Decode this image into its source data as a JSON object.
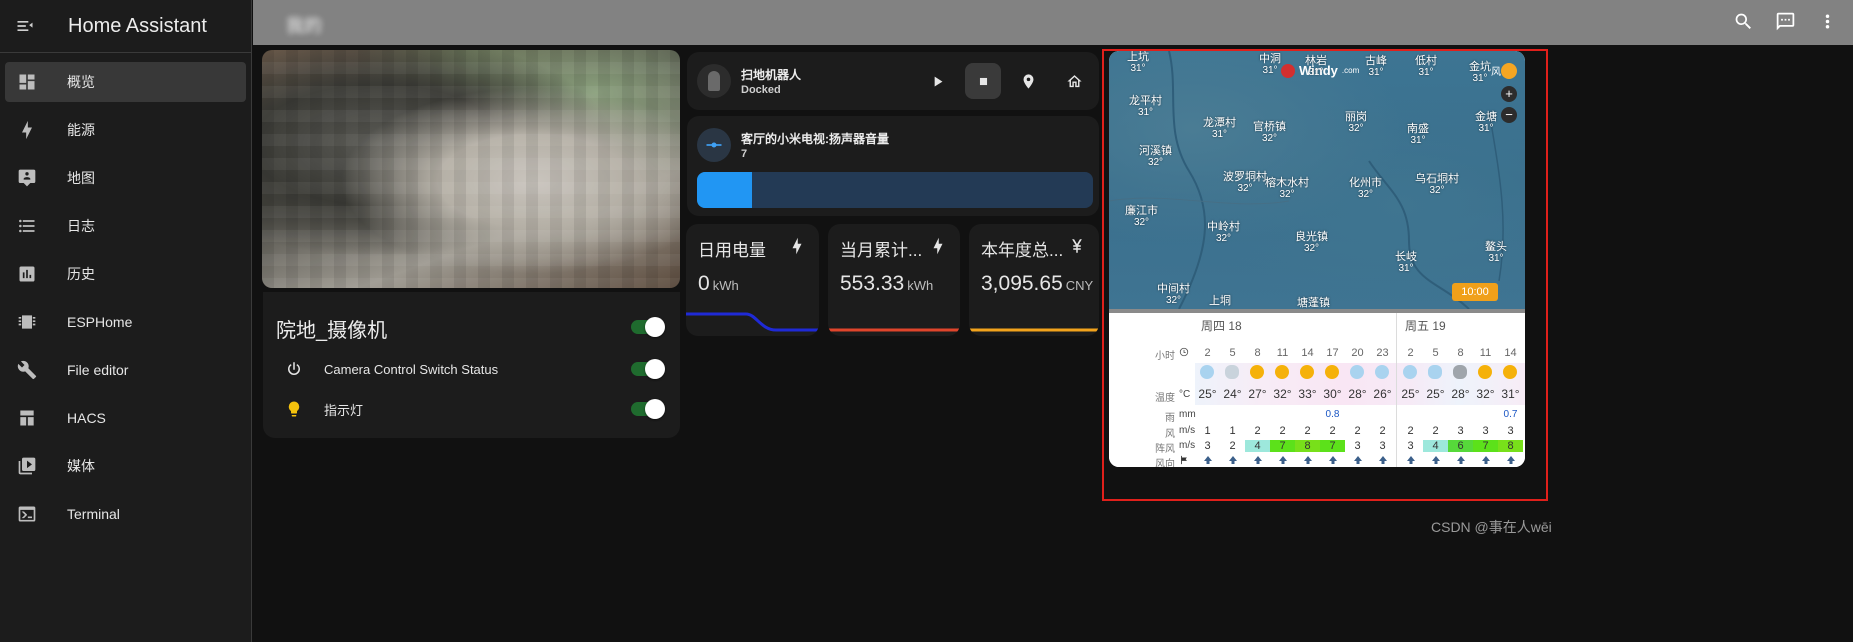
{
  "app": {
    "title": "Home Assistant"
  },
  "sidebar": {
    "items": [
      {
        "label": "概览",
        "icon": "dashboard-icon",
        "active": true
      },
      {
        "label": "能源",
        "icon": "lightning-icon",
        "active": false
      },
      {
        "label": "地图",
        "icon": "map-icon",
        "active": false
      },
      {
        "label": "日志",
        "icon": "list-icon",
        "active": false
      },
      {
        "label": "历史",
        "icon": "chart-box-icon",
        "active": false
      },
      {
        "label": "ESPHome",
        "icon": "chip-icon",
        "active": false
      },
      {
        "label": "File editor",
        "icon": "wrench-icon",
        "active": false
      },
      {
        "label": "HACS",
        "icon": "hacs-icon",
        "active": false
      },
      {
        "label": "媒体",
        "icon": "media-icon",
        "active": false
      },
      {
        "label": "Terminal",
        "icon": "terminal-icon",
        "active": false
      }
    ]
  },
  "topbar": {
    "title": "我的"
  },
  "camera": {
    "title": "院地_摄像机",
    "rows": [
      {
        "label": "Camera Control Switch Status",
        "icon": "power-icon",
        "on": true
      },
      {
        "label": "指示灯",
        "icon": "bulb-icon",
        "on": true
      }
    ]
  },
  "vacuum": {
    "name": "扫地机器人",
    "state": "Docked"
  },
  "tv": {
    "name": "客厅的小米电视:扬声器音量",
    "value": "7",
    "level_percent": 14
  },
  "energy": [
    {
      "title": "日用电量",
      "value": "0",
      "unit": "kWh",
      "icon": "lightning-icon",
      "line_color": "#1f2ad6"
    },
    {
      "title": "当月累计...",
      "value": "553.33",
      "unit": "kWh",
      "icon": "lightning-icon",
      "line_color": "#e0452b"
    },
    {
      "title": "本年度总...",
      "value": "3,095.65",
      "unit": "CNY",
      "icon": "yen-icon",
      "line_color": "#f2a31c"
    }
  ],
  "windy": {
    "logo": "Windy",
    "logo_sub": ".com",
    "layer_label": "风",
    "time_badge": "10:00",
    "map_labels": [
      {
        "name": "上坑",
        "temp": "31°"
      },
      {
        "name": "中洞",
        "temp": "31°"
      },
      {
        "name": "林岩",
        "temp": "31°"
      },
      {
        "name": "古峰",
        "temp": "31°"
      },
      {
        "name": "低村",
        "temp": "31°"
      },
      {
        "name": "金坑",
        "temp": "31°"
      },
      {
        "name": "龙平村",
        "temp": "31°"
      },
      {
        "name": "龙潭村",
        "temp": "31°"
      },
      {
        "name": "官桥镇",
        "temp": "32°"
      },
      {
        "name": "丽岗",
        "temp": "32°"
      },
      {
        "name": "南盛",
        "temp": "31°"
      },
      {
        "name": "金塘",
        "temp": "31°"
      },
      {
        "name": "河溪镇",
        "temp": "32°"
      },
      {
        "name": "波罗垌村",
        "temp": "32°"
      },
      {
        "name": "榕木水村",
        "temp": "32°"
      },
      {
        "name": "化州市",
        "temp": "32°"
      },
      {
        "name": "乌石垌村",
        "temp": "32°"
      },
      {
        "name": "廉江市",
        "temp": "32°"
      },
      {
        "name": "中岭村",
        "temp": "32°"
      },
      {
        "name": "良光镇",
        "temp": "32°"
      },
      {
        "name": "长岐",
        "temp": "31°"
      },
      {
        "name": "鳌头",
        "temp": "31°"
      },
      {
        "name": "中间村",
        "temp": "32°"
      },
      {
        "name": "上垌",
        "temp": ""
      },
      {
        "name": "塘蓬镇",
        "temp": ""
      }
    ],
    "forecast": {
      "days": [
        "周四 18",
        "周五 19"
      ],
      "row_labels": {
        "hour": "小时",
        "temp": "温度",
        "rain": "雨",
        "wind": "风",
        "gust": "阵风",
        "dir": "风向"
      },
      "units": {
        "temp": "°C",
        "rain": "mm",
        "wind": "m/s",
        "gust": "m/s"
      },
      "hours": [
        "2",
        "5",
        "8",
        "11",
        "14",
        "17",
        "20",
        "23",
        "2",
        "5",
        "8",
        "11",
        "14"
      ],
      "temps": [
        "25°",
        "24°",
        "27°",
        "32°",
        "33°",
        "30°",
        "28°",
        "26°",
        "25°",
        "25°",
        "28°",
        "32°",
        "31°"
      ],
      "rain": [
        "",
        "",
        "",
        "",
        "",
        "0.8",
        "",
        "",
        "",
        "",
        "",
        "",
        "0.7"
      ],
      "wind": [
        "1",
        "1",
        "2",
        "2",
        "2",
        "2",
        "2",
        "2",
        "2",
        "2",
        "3",
        "3",
        "3"
      ],
      "gust": [
        "3",
        "2",
        "4",
        "7",
        "8",
        "7",
        "3",
        "3",
        "3",
        "4",
        "6",
        "7",
        "8"
      ],
      "weather": [
        "clear-night",
        "fog",
        "sunny",
        "sunny",
        "partly-sunny",
        "partly-sunny",
        "clear-night",
        "clear-night",
        "clear-night",
        "cloudy-night",
        "cloudy",
        "partly-sunny",
        "rain-sun"
      ]
    }
  },
  "watermark": "CSDN @事在人wēi"
}
